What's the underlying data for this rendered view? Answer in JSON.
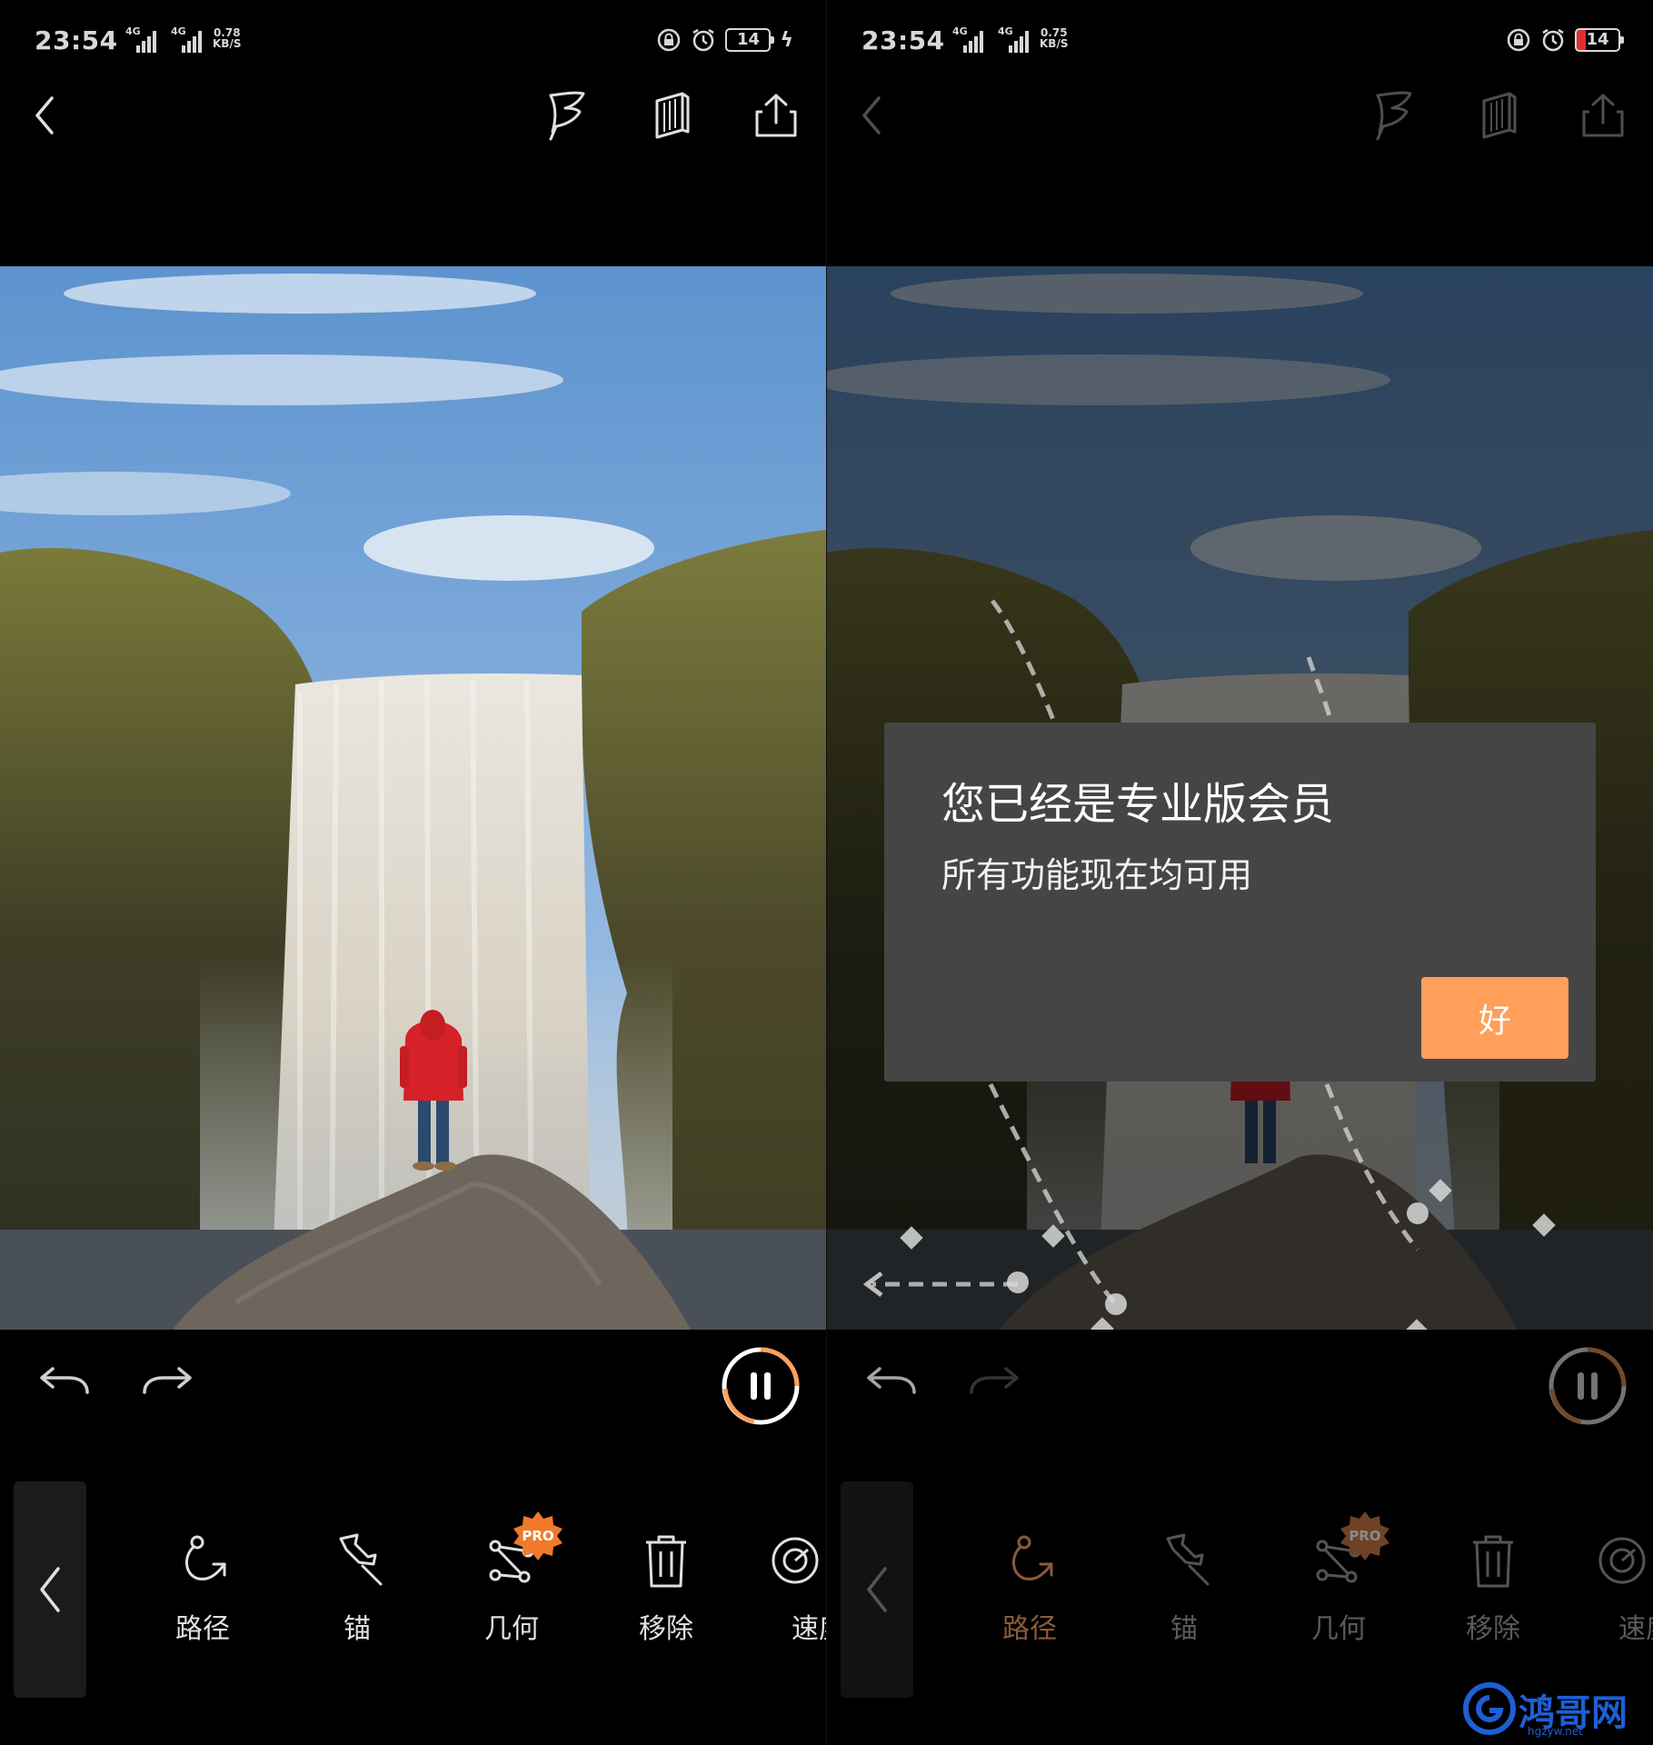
{
  "left": {
    "status": {
      "time": "23:54",
      "network": "4G",
      "speed_value": "0.78",
      "speed_unit": "KB/S",
      "battery": "14"
    },
    "tools": [
      {
        "label": "路径",
        "icon": "path-icon"
      },
      {
        "label": "锚",
        "icon": "pin-icon"
      },
      {
        "label": "几何",
        "icon": "geometry-icon",
        "badge": "PRO"
      },
      {
        "label": "移除",
        "icon": "trash-icon"
      },
      {
        "label": "速度",
        "icon": "speed-icon"
      }
    ],
    "playing": true
  },
  "right": {
    "status": {
      "time": "23:54",
      "network": "4G",
      "speed_value": "0.75",
      "speed_unit": "KB/S",
      "battery": "14"
    },
    "tools": [
      {
        "label": "路径",
        "icon": "path-icon"
      },
      {
        "label": "锚",
        "icon": "pin-icon"
      },
      {
        "label": "几何",
        "icon": "geometry-icon",
        "badge": "PRO"
      },
      {
        "label": "移除",
        "icon": "trash-icon"
      },
      {
        "label": "速度",
        "icon": "speed-icon"
      }
    ],
    "dialog": {
      "title": "您已经是专业版会员",
      "message": "所有功能现在均可用",
      "ok_label": "好"
    }
  },
  "watermark": {
    "text": "鸿哥网",
    "url": "hgzyw.net"
  },
  "colors": {
    "accent": "#ff9f5a",
    "dialog_bg": "#454545",
    "pro_badge": "#f07a2a"
  }
}
